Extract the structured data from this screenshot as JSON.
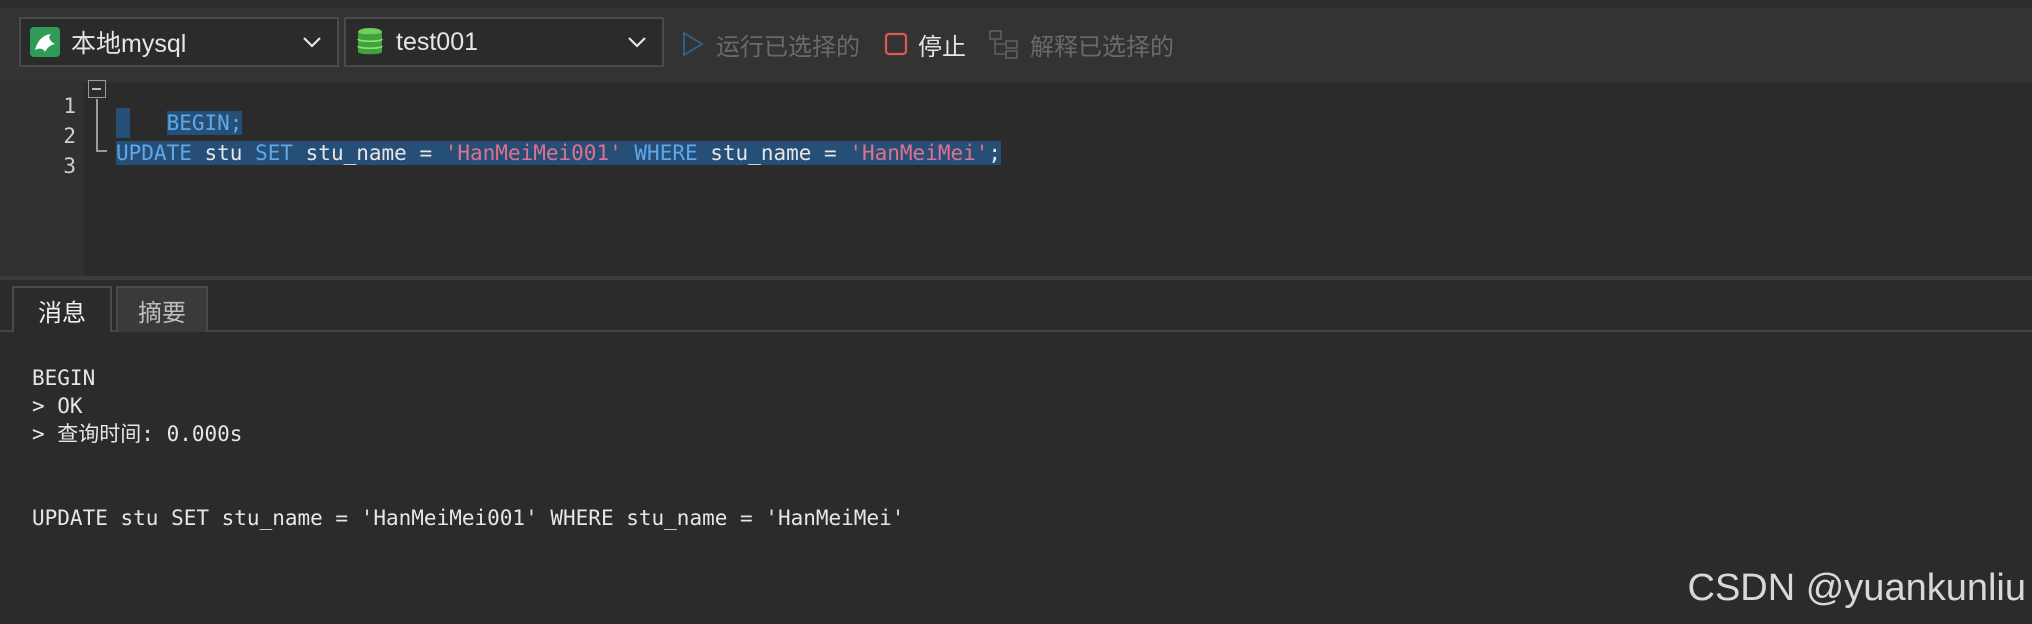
{
  "toolbar": {
    "connection": {
      "label": "本地mysql",
      "icon": "mysql-connection-icon"
    },
    "database": {
      "label": "test001",
      "icon": "database-icon"
    },
    "run_selected": {
      "label": "运行已选择的",
      "enabled": false
    },
    "stop": {
      "label": "停止",
      "enabled": true
    },
    "explain_selected": {
      "label": "解释已选择的",
      "enabled": false
    }
  },
  "editor": {
    "line_numbers": [
      "1",
      "2",
      "3"
    ],
    "line1": {
      "text": "BEGIN;"
    },
    "line3": {
      "kw_update": "UPDATE",
      "t1": " stu ",
      "kw_set": "SET",
      "t2": " stu_name = ",
      "s1": "'HanMeiMei001'",
      "t3": " ",
      "kw_where": "WHERE",
      "t4": " stu_name = ",
      "s2": "'HanMeiMei'",
      "t5": ";"
    }
  },
  "tabs": [
    {
      "label": "消息",
      "active": true
    },
    {
      "label": "摘要",
      "active": false
    }
  ],
  "output": {
    "lines": [
      "BEGIN",
      "> OK",
      "> 查询时间: 0.000s",
      "UPDATE stu SET stu_name = 'HanMeiMei001' WHERE stu_name = 'HanMeiMei'"
    ]
  },
  "watermark": "CSDN @yuankunliu",
  "colors": {
    "background": "#2b2b2b",
    "keyword": "#5fa8e8",
    "string": "#e0708f",
    "selection": "#264f78",
    "stop_icon": "#e05a4f"
  }
}
